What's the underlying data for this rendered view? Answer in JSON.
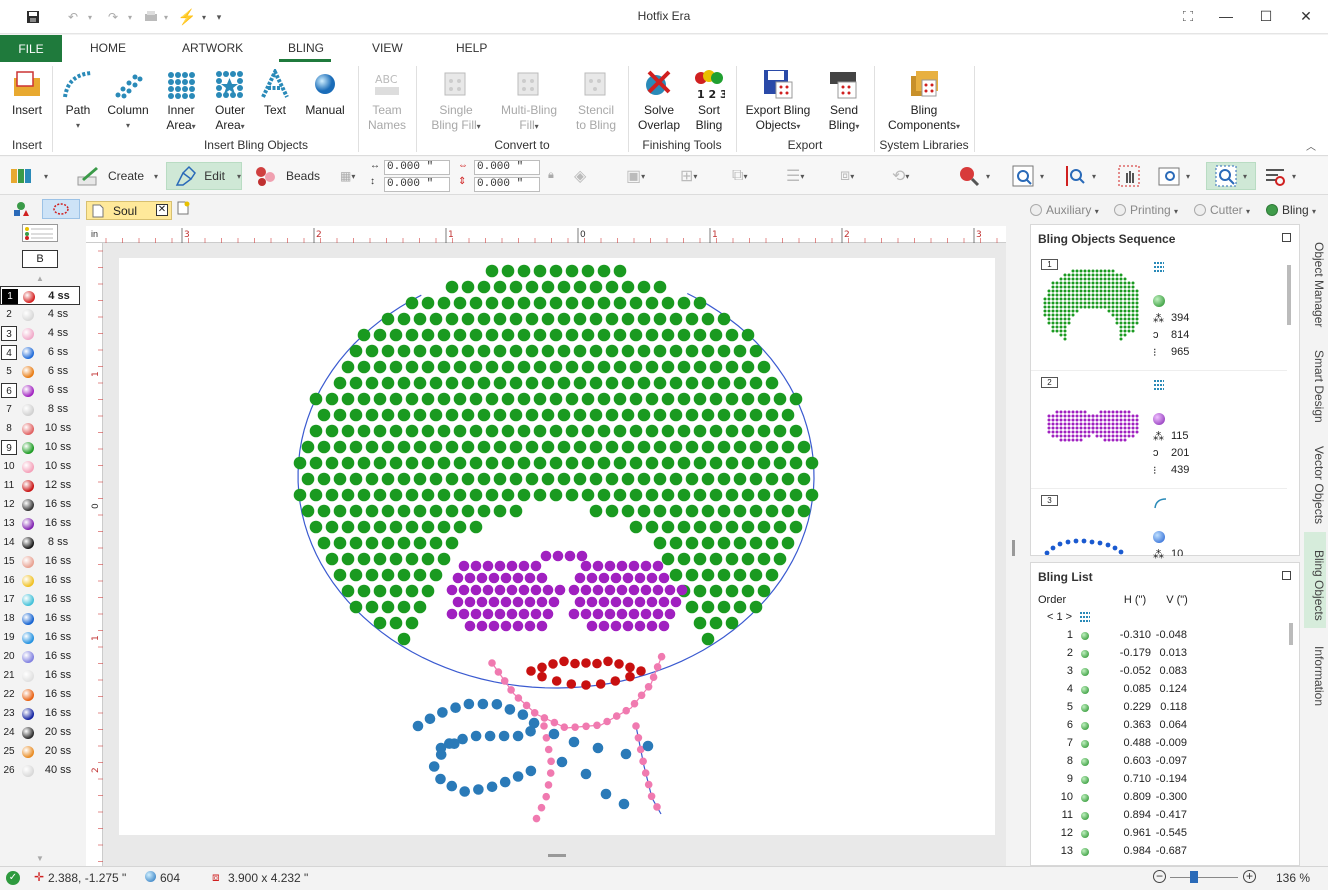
{
  "window": {
    "title": "Hotfix Era",
    "minimize": "—",
    "maximize": "☐",
    "close": "✕"
  },
  "ribbon_tabs": [
    "FILE",
    "HOME",
    "ARTWORK",
    "BLING",
    "VIEW",
    "HELP"
  ],
  "ribbon": {
    "insert": "Insert",
    "path": "Path",
    "column": "Column",
    "inner_area_1": "Inner",
    "inner_area_2": "Area",
    "outer_area_1": "Outer",
    "outer_area_2": "Area",
    "text": "Text",
    "manual": "Manual",
    "team_names_1": "Team",
    "team_names_2": "Names",
    "single_fill_1": "Single",
    "single_fill_2": "Bling Fill",
    "multi_fill_1": "Multi-Bling",
    "multi_fill_2": "Fill",
    "stencil_1": "Stencil",
    "stencil_2": "to Bling",
    "solve_1": "Solve",
    "solve_2": "Overlap",
    "sort_1": "Sort",
    "sort_2": "Bling",
    "export_1": "Export Bling",
    "export_2": "Objects",
    "send_1": "Send",
    "send_2": "Bling",
    "comp_1": "Bling",
    "comp_2": "Components",
    "groups": {
      "insert": "Insert",
      "insert_bling_objects": "Insert Bling Objects",
      "convert_to": "Convert to",
      "finishing_tools": "Finishing Tools",
      "export": "Export",
      "system_libraries": "System Libraries"
    }
  },
  "toolbar": {
    "create": "Create",
    "edit": "Edit",
    "beads": "Beads",
    "x": "0.000 \"",
    "y": "0.000 \"",
    "w": "0.000 \"",
    "h": "0.000 \""
  },
  "doc": {
    "tab": "Soul",
    "stone_b": "B"
  },
  "modes": [
    "Auxiliary",
    "Printing",
    "Cutter",
    "Bling"
  ],
  "stones": [
    {
      "n": "1",
      "size": "4 ss",
      "color": "#d42020"
    },
    {
      "n": "2",
      "size": "4 ss",
      "color": "#d8d8d8"
    },
    {
      "n": "3",
      "size": "4 ss",
      "color": "#f0a8c8"
    },
    {
      "n": "4",
      "size": "6 ss",
      "color": "#1f6ad8"
    },
    {
      "n": "5",
      "size": "6 ss",
      "color": "#e87a10"
    },
    {
      "n": "6",
      "size": "6 ss",
      "color": "#a020c0"
    },
    {
      "n": "7",
      "size": "8 ss",
      "color": "#d0d0d0"
    },
    {
      "n": "8",
      "size": "10 ss",
      "color": "#e06060"
    },
    {
      "n": "9",
      "size": "10 ss",
      "color": "#1a9a20"
    },
    {
      "n": "10",
      "size": "10 ss",
      "color": "#f4a0b8"
    },
    {
      "n": "11",
      "size": "12 ss",
      "color": "#c81010"
    },
    {
      "n": "12",
      "size": "16 ss",
      "color": "#333333"
    },
    {
      "n": "13",
      "size": "16 ss",
      "color": "#8020b0"
    },
    {
      "n": "14",
      "size": "8 ss",
      "color": "#151515"
    },
    {
      "n": "15",
      "size": "16 ss",
      "color": "#e8a090"
    },
    {
      "n": "16",
      "size": "16 ss",
      "color": "#f0c020"
    },
    {
      "n": "17",
      "size": "16 ss",
      "color": "#40c0d8"
    },
    {
      "n": "18",
      "size": "16 ss",
      "color": "#1060d0"
    },
    {
      "n": "19",
      "size": "16 ss",
      "color": "#2090e0"
    },
    {
      "n": "20",
      "size": "16 ss",
      "color": "#8080e0"
    },
    {
      "n": "21",
      "size": "16 ss",
      "color": "#e0e0e0"
    },
    {
      "n": "22",
      "size": "16 ss",
      "color": "#e86010"
    },
    {
      "n": "23",
      "size": "16 ss",
      "color": "#1020a0"
    },
    {
      "n": "24",
      "size": "20 ss",
      "color": "#2a2a2a"
    },
    {
      "n": "25",
      "size": "20 ss",
      "color": "#e88a20"
    },
    {
      "n": "26",
      "size": "40 ss",
      "color": "#d8d8d8"
    }
  ],
  "ruler_h": [
    "3",
    "2",
    "1",
    "0",
    "1",
    "2",
    "3"
  ],
  "ruler_v": [
    "1",
    "0",
    "1",
    "2"
  ],
  "ruler_unit": "in",
  "sequence": {
    "title": "Bling Objects Sequence",
    "items": [
      {
        "n": "1",
        "count": "394",
        "length": "814",
        "total": "965"
      },
      {
        "n": "2",
        "count": "115",
        "length": "201",
        "total": "439"
      },
      {
        "n": "3",
        "count": "10"
      }
    ]
  },
  "bling_list": {
    "title": "Bling List",
    "col_order": "Order",
    "col_h": "H (\")",
    "col_v": "V (\")",
    "group": "< 1 >",
    "rows": [
      {
        "n": "1",
        "h": "-0.310",
        "v": "-0.048"
      },
      {
        "n": "2",
        "h": "-0.179",
        "v": "0.013"
      },
      {
        "n": "3",
        "h": "-0.052",
        "v": "0.083"
      },
      {
        "n": "4",
        "h": "0.085",
        "v": "0.124"
      },
      {
        "n": "5",
        "h": "0.229",
        "v": "0.118"
      },
      {
        "n": "6",
        "h": "0.363",
        "v": "0.064"
      },
      {
        "n": "7",
        "h": "0.488",
        "v": "-0.009"
      },
      {
        "n": "8",
        "h": "0.603",
        "v": "-0.097"
      },
      {
        "n": "9",
        "h": "0.710",
        "v": "-0.194"
      },
      {
        "n": "10",
        "h": "0.809",
        "v": "-0.300"
      },
      {
        "n": "11",
        "h": "0.894",
        "v": "-0.417"
      },
      {
        "n": "12",
        "h": "0.961",
        "v": "-0.545"
      },
      {
        "n": "13",
        "h": "0.984",
        "v": "-0.687"
      }
    ]
  },
  "side_tabs": [
    "Object Manager",
    "Smart Design",
    "Vector Objects",
    "Bling Objects",
    "Information"
  ],
  "status": {
    "coords": "2.388, -1.275 \"",
    "count": "604",
    "size": "3.900 x 4.232 \"",
    "zoom": "136 %"
  },
  "colors": {
    "accent": "#1f7a3c",
    "hair": "#1a9a20",
    "glasses": "#a020c0",
    "lips": "#c81010",
    "necklace": "#f07ab0",
    "collar": "#2a7ab8"
  }
}
